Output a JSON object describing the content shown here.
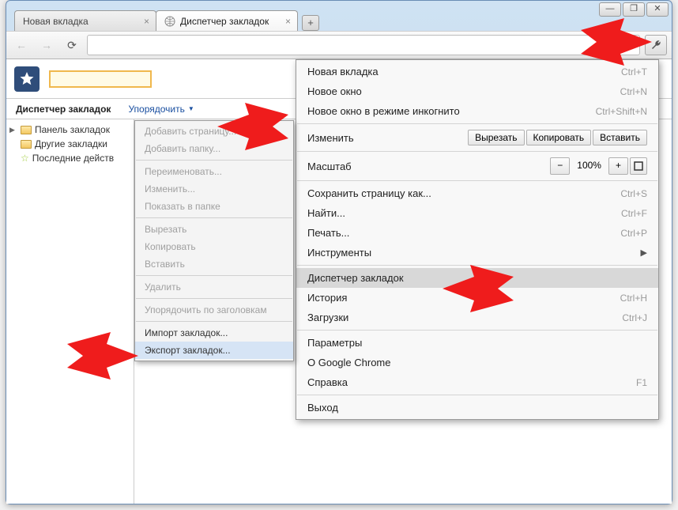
{
  "window": {
    "minimize": "—",
    "maximize": "❐",
    "close": "✕"
  },
  "tabs": {
    "t0": {
      "label": "Новая вкладка"
    },
    "t1": {
      "label": "Диспетчер закладок"
    },
    "newtab": "+"
  },
  "toolbar": {
    "back": "←",
    "forward": "→",
    "reload": "⟳"
  },
  "bookmark_manager": {
    "title": "Диспетчер закладок",
    "organize": "Упорядочить",
    "tree": {
      "bar": "Панель закладок",
      "other": "Другие закладки",
      "recent": "Последние действ"
    }
  },
  "submenu": {
    "add_page": "Добавить страницу...",
    "add_folder": "Добавить папку...",
    "rename": "Переименовать...",
    "edit": "Изменить...",
    "show_in_folder": "Показать в папке",
    "cut": "Вырезать",
    "copy": "Копировать",
    "paste": "Вставить",
    "delete": "Удалить",
    "sort": "Упорядочить по заголовкам",
    "import": "Импорт закладок...",
    "export": "Экспорт закладок..."
  },
  "wrench_menu": {
    "new_tab": {
      "label": "Новая вкладка",
      "shortcut": "Ctrl+T"
    },
    "new_window": {
      "label": "Новое окно",
      "shortcut": "Ctrl+N"
    },
    "incognito": {
      "label": "Новое окно в режиме инкогнито",
      "shortcut": "Ctrl+Shift+N"
    },
    "edit_row": {
      "label": "Изменить",
      "cut": "Вырезать",
      "copy": "Копировать",
      "paste": "Вставить"
    },
    "zoom_row": {
      "label": "Масштаб",
      "minus": "−",
      "value": "100%",
      "plus": "+"
    },
    "save_as": {
      "label": "Сохранить страницу как...",
      "shortcut": "Ctrl+S"
    },
    "find": {
      "label": "Найти...",
      "shortcut": "Ctrl+F"
    },
    "print": {
      "label": "Печать...",
      "shortcut": "Ctrl+P"
    },
    "tools": {
      "label": "Инструменты"
    },
    "bm_mgr": {
      "label": "Диспетчер закладок"
    },
    "history": {
      "label": "История",
      "shortcut": "Ctrl+H"
    },
    "downloads": {
      "label": "Загрузки",
      "shortcut": "Ctrl+J"
    },
    "settings": {
      "label": "Параметры"
    },
    "about": {
      "label": "О Google Chrome"
    },
    "help": {
      "label": "Справка",
      "shortcut": "F1"
    },
    "exit": {
      "label": "Выход"
    }
  }
}
